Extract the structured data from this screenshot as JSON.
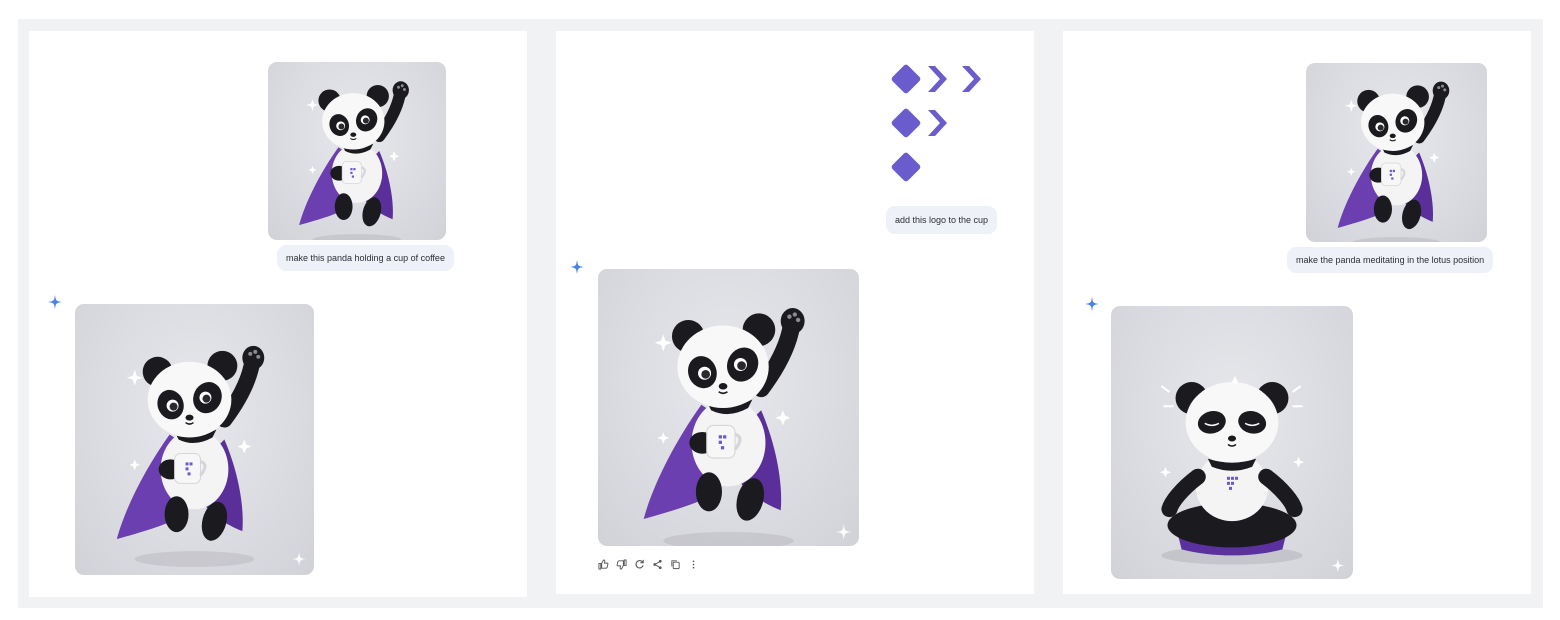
{
  "colors": {
    "accent": "#6a5ccc",
    "gemini_blue": "#4a82e8",
    "bubble": "#eef1f7",
    "frame": "#f1f2f3"
  },
  "panels": [
    {
      "prompt": "make this panda holding a cup of coffee",
      "input_image": "panda-superhero-waving",
      "output_image": "panda-with-coffee-cup"
    },
    {
      "prompt": "add this logo to the cup",
      "input_image": "purple-diamond-chevron-logo",
      "output_image": "panda-with-logo-cup",
      "actions": [
        "thumbs-up-icon",
        "thumbs-down-icon",
        "regenerate-icon",
        "share-icon",
        "copy-icon",
        "more-icon"
      ]
    },
    {
      "prompt": "make the panda meditating in the lotus position",
      "input_image": "panda-superhero-waving",
      "output_image": "panda-meditating-lotus"
    }
  ]
}
